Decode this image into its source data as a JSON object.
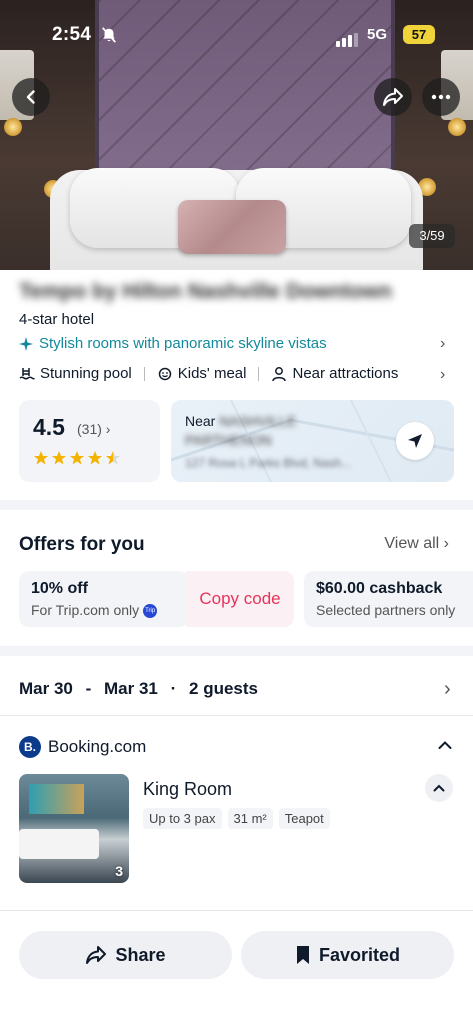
{
  "status_bar": {
    "time": "2:54",
    "network": "5G",
    "battery": "57"
  },
  "hero": {
    "photo_counter": "3/59"
  },
  "hotel": {
    "name": "Tempo by Hilton Nashville Downtown",
    "star_label": "4-star hotel",
    "highlight": "Stylish rooms with panoramic skyline vistas",
    "amenities": [
      "Stunning pool",
      "Kids' meal",
      "Near attractions"
    ]
  },
  "rating": {
    "score": "4.5",
    "count": "(31)",
    "stars": 4.5
  },
  "location": {
    "near_prefix": "Near",
    "near_line1": "NASHVILLE",
    "near_line2": "PARTHENON",
    "address": "127 Rosa L Parks Blvd, Nash..."
  },
  "offers": {
    "title": "Offers for you",
    "view_all": "View all",
    "items": [
      {
        "title": "10% off",
        "subtitle": "For Trip.com only",
        "badge": "Trip"
      },
      {
        "title": "$60.00 cashback",
        "subtitle": "Selected partners only"
      }
    ],
    "copy_code": "Copy code"
  },
  "stay": {
    "check_in": "Mar 30",
    "dash": "-",
    "check_out": "Mar 31",
    "dot": "·",
    "guests": "2 guests"
  },
  "provider": {
    "logo": "B.",
    "name": "Booking.com"
  },
  "room": {
    "name": "King Room",
    "image_count": "3",
    "tags": [
      "Up to 3 pax",
      "31 m²",
      "Teapot"
    ]
  },
  "bottom": {
    "share": "Share",
    "favorited": "Favorited"
  },
  "colors": {
    "accent_teal": "#128a9a",
    "copy_code_red": "#e8335b",
    "star_gold": "#f5b301",
    "booking_blue": "#0c3b8c"
  }
}
